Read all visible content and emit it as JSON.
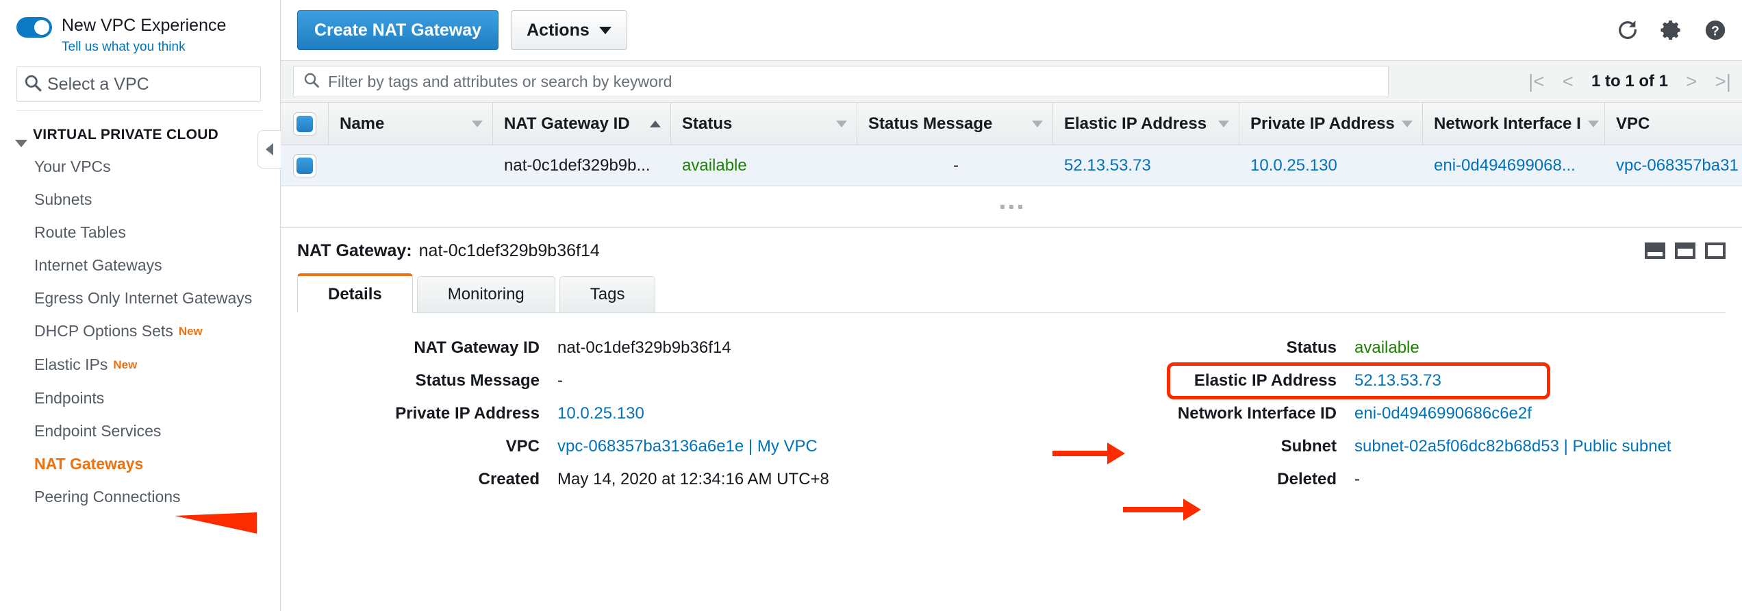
{
  "sidebar": {
    "new_experience": {
      "title": "New VPC Experience",
      "feedback_link": "Tell us what you think"
    },
    "vpc_selector": {
      "placeholder": "Select a VPC",
      "icon": "search-icon"
    },
    "section_title": "VIRTUAL PRIVATE CLOUD",
    "items": [
      {
        "label": "Your VPCs",
        "badge": "",
        "active": false
      },
      {
        "label": "Subnets",
        "badge": "",
        "active": false
      },
      {
        "label": "Route Tables",
        "badge": "",
        "active": false
      },
      {
        "label": "Internet Gateways",
        "badge": "",
        "active": false
      },
      {
        "label": "Egress Only Internet Gateways",
        "badge": "",
        "active": false
      },
      {
        "label": "DHCP Options Sets",
        "badge": "New",
        "active": false
      },
      {
        "label": "Elastic IPs",
        "badge": "New",
        "active": false
      },
      {
        "label": "Endpoints",
        "badge": "",
        "active": false
      },
      {
        "label": "Endpoint Services",
        "badge": "",
        "active": false
      },
      {
        "label": "NAT Gateways",
        "badge": "",
        "active": true
      },
      {
        "label": "Peering Connections",
        "badge": "",
        "active": false
      }
    ]
  },
  "toolbar": {
    "create_label": "Create NAT Gateway",
    "actions_label": "Actions",
    "icons": [
      "refresh-icon",
      "gear-icon",
      "help-icon"
    ]
  },
  "filter": {
    "placeholder": "Filter by tags and attributes or search by keyword",
    "value": "",
    "pagination_text": "1 to 1 of 1"
  },
  "table": {
    "columns": [
      {
        "label": "Name",
        "sort": "none"
      },
      {
        "label": "NAT Gateway ID",
        "sort": "asc"
      },
      {
        "label": "Status",
        "sort": "none"
      },
      {
        "label": "Status Message",
        "sort": "none"
      },
      {
        "label": "Elastic IP Address",
        "sort": "none"
      },
      {
        "label": "Private IP Address",
        "sort": "none"
      },
      {
        "label": "Network Interface I",
        "sort": "none"
      },
      {
        "label": "VPC",
        "sort": "none"
      }
    ],
    "rows": [
      {
        "selected": true,
        "name": "",
        "nat_gateway_id": "nat-0c1def329b9b...",
        "status": "available",
        "status_message": "-",
        "elastic_ip": "52.13.53.73",
        "private_ip": "10.0.25.130",
        "network_interface": "eni-0d494699068...",
        "vpc": "vpc-068357ba31"
      }
    ]
  },
  "detail": {
    "header_label": "NAT Gateway:",
    "header_value": "nat-0c1def329b9b36f14",
    "tabs": [
      {
        "label": "Details",
        "active": true
      },
      {
        "label": "Monitoring",
        "active": false
      },
      {
        "label": "Tags",
        "active": false
      }
    ],
    "left_fields": [
      {
        "label": "NAT Gateway ID",
        "value": "nat-0c1def329b9b36f14",
        "style": "plain"
      },
      {
        "label": "Status Message",
        "value": "-",
        "style": "plain"
      },
      {
        "label": "Private IP Address",
        "value": "10.0.25.130",
        "style": "link"
      },
      {
        "label": "VPC",
        "value": "vpc-068357ba3136a6e1e | My VPC",
        "style": "link"
      },
      {
        "label": "Created",
        "value": "May 14, 2020 at 12:34:16 AM UTC+8",
        "style": "plain"
      }
    ],
    "right_fields": [
      {
        "label": "Status",
        "value": "available",
        "style": "ok",
        "highlighted": false
      },
      {
        "label": "Elastic IP Address",
        "value": "52.13.53.73",
        "style": "link",
        "highlighted": true
      },
      {
        "label": "Network Interface ID",
        "value": "eni-0d4946990686c6e2f",
        "style": "link",
        "highlighted": false
      },
      {
        "label": "Subnet",
        "value": "subnet-02a5f06dc82b68d53 | Public subnet",
        "style": "link",
        "highlighted": false
      },
      {
        "label": "Deleted",
        "value": "-",
        "style": "plain",
        "highlighted": false
      }
    ],
    "panel_icons": [
      "panel-small-icon",
      "panel-medium-icon",
      "panel-large-icon"
    ]
  },
  "colors": {
    "accent_orange": "#ec7211",
    "link_blue": "#0073bb",
    "primary_blue": "#1f7ec2",
    "status_green": "#1d8102",
    "annotation_red": "#fc2b00"
  }
}
